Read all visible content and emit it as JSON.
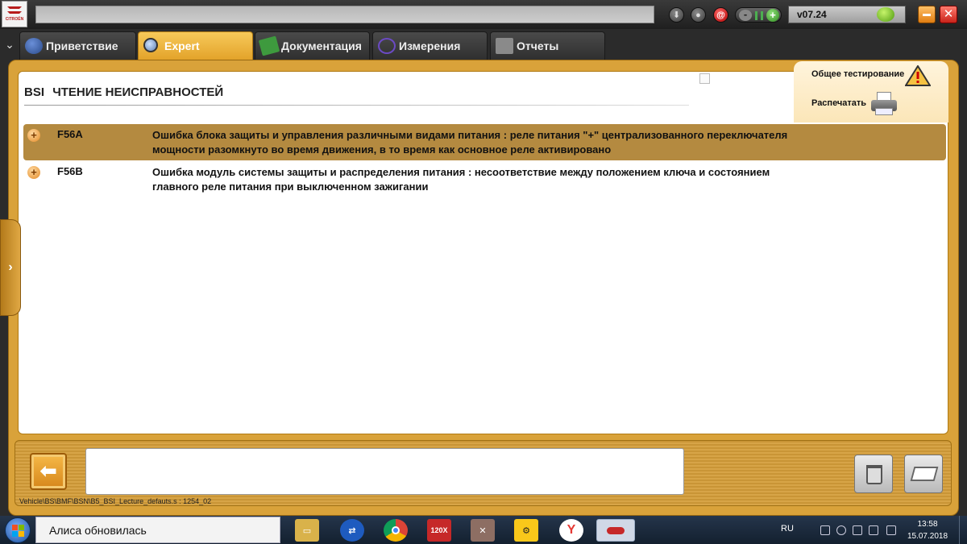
{
  "app": {
    "logo_text": "CITROËN",
    "version": "v07.24",
    "colors": {
      "accent": "#e3a32a",
      "frame": "#d9a23a",
      "selected_row": "#b48a40"
    }
  },
  "top_icons": [
    "download-icon",
    "user-icon",
    "mail-at-icon",
    "connection-status-icon",
    "drop-icon"
  ],
  "tabs": [
    {
      "label": "Приветствие",
      "icon": "globe-icon",
      "active": false
    },
    {
      "label": "Expert",
      "icon": "magnifier-icon",
      "active": true
    },
    {
      "label": "Документация",
      "icon": "book-icon",
      "active": false
    },
    {
      "label": "Измерения",
      "icon": "waveform-icon",
      "active": false
    },
    {
      "label": "Отчеты",
      "icon": "report-icon",
      "active": false
    }
  ],
  "page": {
    "system": "BSI",
    "title": "ЧТЕНИЕ НЕИСПРАВНОСТЕЙ"
  },
  "tools": {
    "global_test_label": "Общее тестирование",
    "print_label": "Распечатать"
  },
  "faults": [
    {
      "code": "F56A",
      "description": "Ошибка блока защиты и управления различными видами питания : реле питания \"+\" централизованного переключателя мощности разомкнуто во время движения, в то время как основное реле активировано",
      "selected": true
    },
    {
      "code": "F56B",
      "description": "Ошибка модуль системы защиты и распределения питания : несоответствие между положением ключа и состоянием главного реле питания при выключенном зажигании",
      "selected": false
    }
  ],
  "bottom": {
    "message": "",
    "path": "Vehicle\\BS\\BMF\\BSN\\B5_BSI_Lecture_defauts.s : 1254_02"
  },
  "taskbar": {
    "search_text": "Алиса обновилась",
    "apps": [
      "file-explorer-icon",
      "teamviewer-icon",
      "chrome-icon",
      "a120x-icon",
      "tool-app-icon",
      "engine-check-icon",
      "yandex-browser-icon",
      "diagbox-icon"
    ],
    "app_labels": {
      "a120x": "120X",
      "yandex": "Y"
    },
    "language": "RU",
    "time": "13:58",
    "date": "15.07.2018"
  }
}
